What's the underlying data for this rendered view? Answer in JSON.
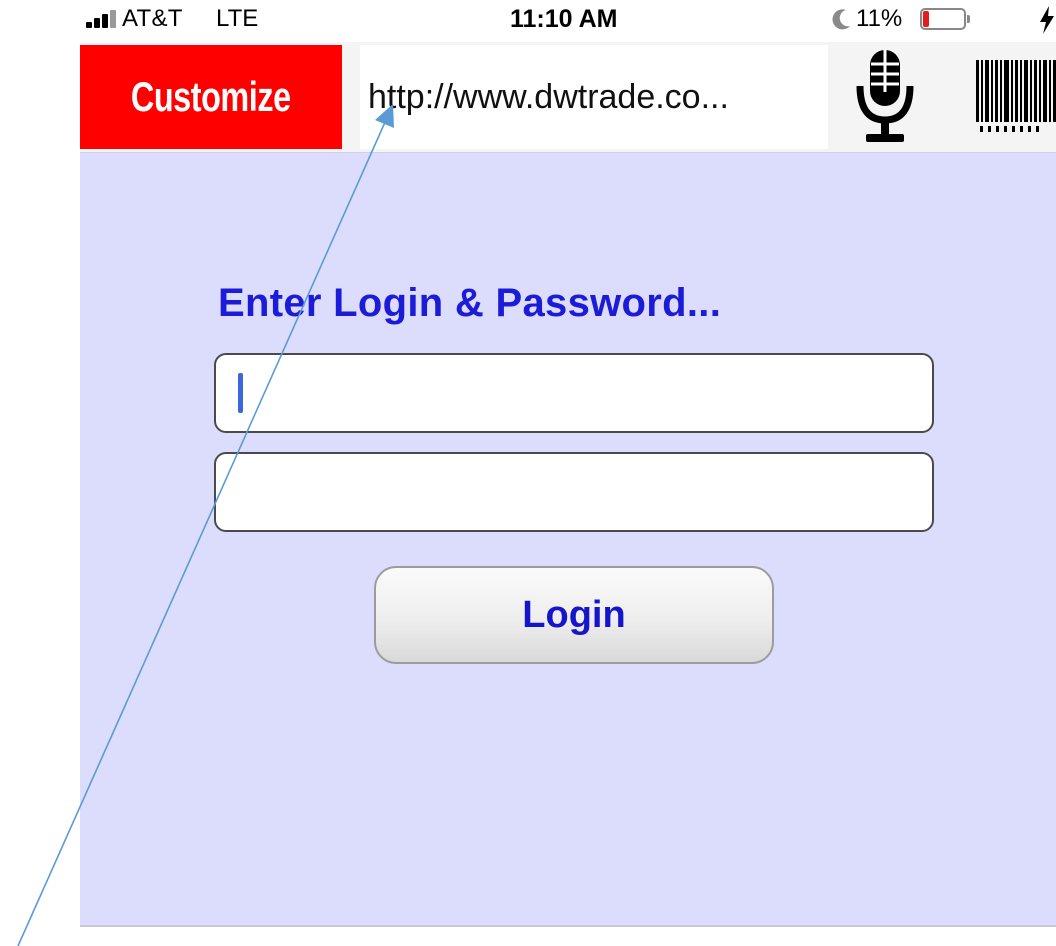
{
  "status_bar": {
    "carrier": "AT&T",
    "network": "LTE",
    "time": "11:10 AM",
    "battery_percent": "11%",
    "icons": [
      "signal-bars-icon",
      "moon-icon",
      "battery-icon",
      "charging-bolt-icon"
    ]
  },
  "toolbar": {
    "customize_label": "Customize",
    "url_value": "http://www.dwtrade.co...",
    "mic_icon": "microphone-icon",
    "barcode_icon": "barcode-icon"
  },
  "login": {
    "heading": "Enter Login & Password...",
    "username_value": "",
    "password_value": "",
    "button_label": "Login"
  },
  "colors": {
    "customize_red": "#ff0000",
    "panel_background": "#dcdcfc",
    "heading_blue": "#1b1bd8",
    "button_text_blue": "#1515cc",
    "annotation_arrow": "#5b9bd5",
    "battery_low": "#e41b1b",
    "caret": "#3a66e0"
  }
}
